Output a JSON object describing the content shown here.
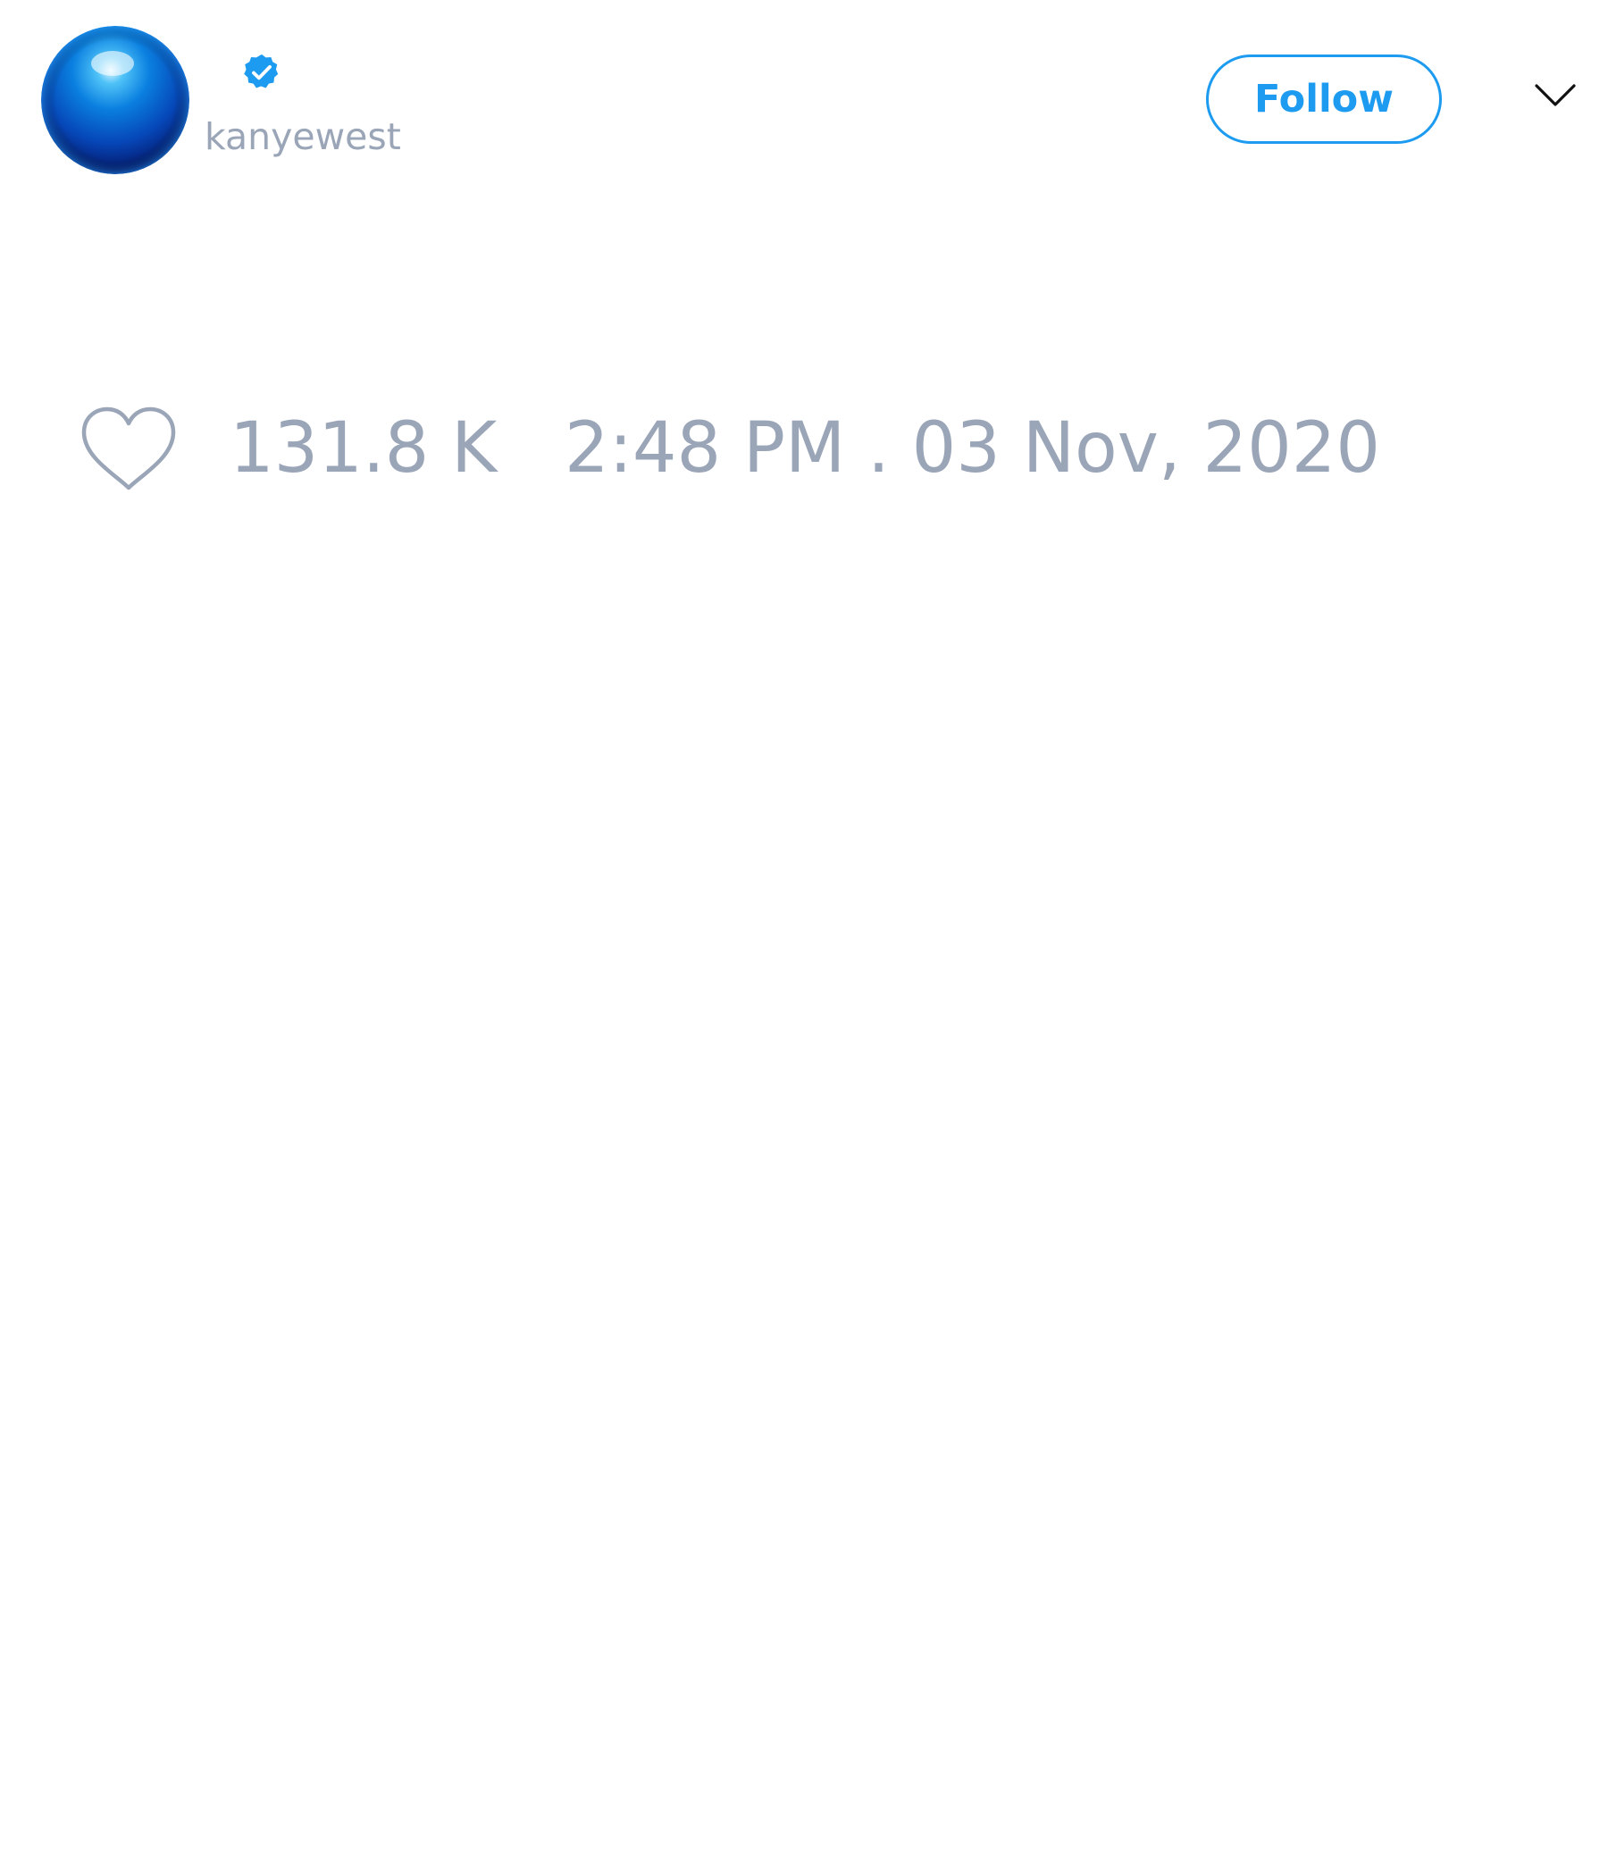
{
  "tweet": {
    "author": {
      "username": "kanyewest",
      "verified": true,
      "avatar": "blue-sphere-avatar"
    },
    "follow_label": "Follow",
    "menu_icon": "chevron-down-icon",
    "like_icon": "heart-outline-icon",
    "like_count": "131.8 K",
    "timestamp": "2:48 PM . 03 Nov, 2020"
  },
  "colors": {
    "accent": "#1d9bf0",
    "muted_text": "#9aa5b8",
    "icon_dark": "#111111",
    "background": "#ffffff"
  }
}
